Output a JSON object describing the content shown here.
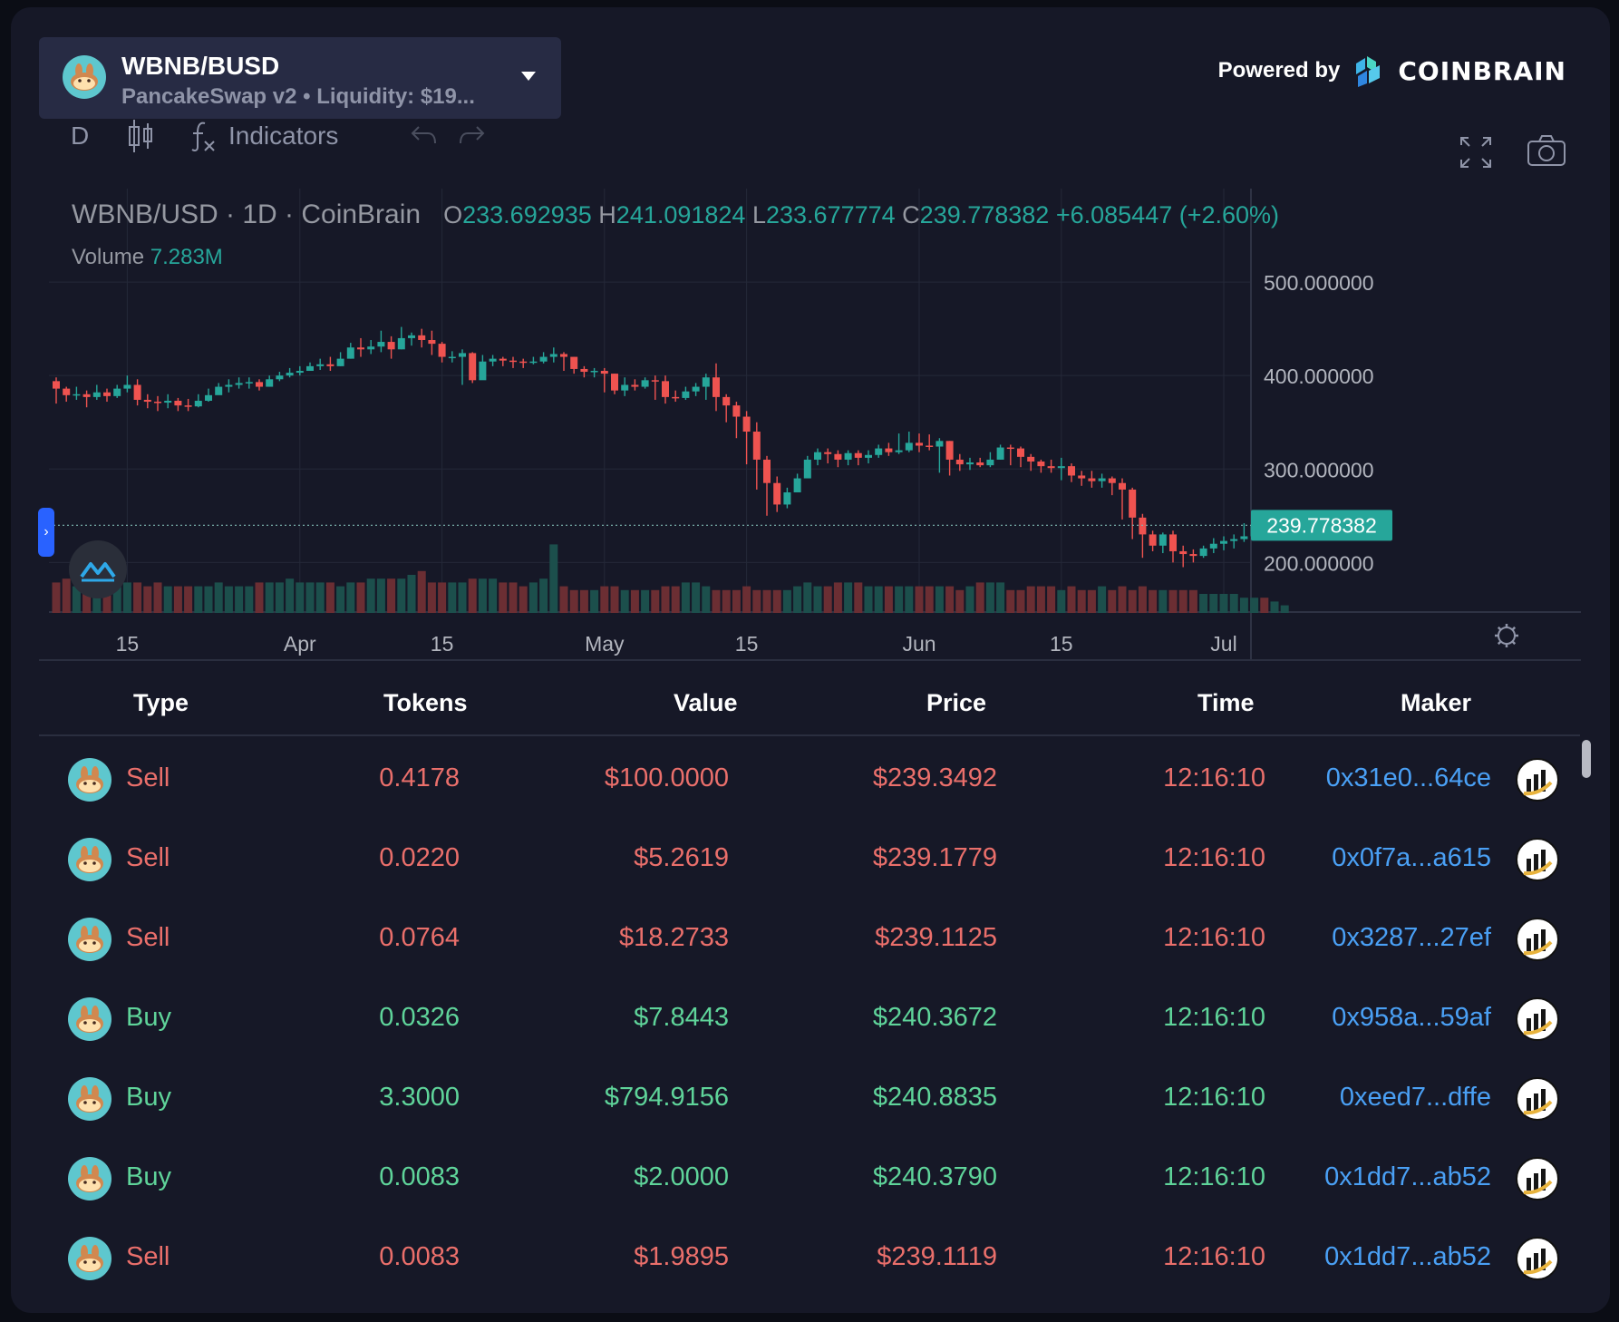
{
  "header": {
    "pair_name": "WBNB/BUSD",
    "pair_sub": "PancakeSwap v2 • Liquidity: $19...",
    "powered_by": "Powered by",
    "brand": "COINBRAIN"
  },
  "toolbar": {
    "interval": "D",
    "indicators": "Indicators"
  },
  "legend": {
    "symbol": "WBNB/USD · 1D · CoinBrain",
    "o_key": "O",
    "o": "233.692935",
    "h_key": "H",
    "h": "241.091824",
    "l_key": "L",
    "l": "233.677774",
    "c_key": "C",
    "c": "239.778382",
    "change": "+6.085447 (+2.60%)",
    "volume_label": "Volume",
    "volume_value": "7.283M"
  },
  "colors": {
    "up": "#26a69a",
    "down": "#ef5350",
    "sell": "#ea6f6b",
    "buy": "#5fd49a",
    "maker": "#4aa0f5"
  },
  "chart_data": {
    "type": "candlestick",
    "title": "WBNB/USD · 1D · CoinBrain",
    "y_ticks": [
      "500.000000",
      "400.000000",
      "300.000000",
      "200.000000"
    ],
    "y_tick_values": [
      500,
      400,
      300,
      200
    ],
    "ylim": [
      146,
      600
    ],
    "x_ticks": [
      "15",
      "Apr",
      "15",
      "May",
      "15",
      "Jun",
      "15",
      "Jul"
    ],
    "x_tick_days": [
      7,
      24,
      38,
      54,
      68,
      85,
      99,
      115
    ],
    "last_price_label": "239.778382",
    "last_price": 239.78,
    "grid": true,
    "closes": [
      386,
      379,
      380,
      377,
      382,
      378,
      386,
      390,
      374,
      372,
      371,
      373,
      368,
      367,
      373,
      379,
      388,
      390,
      392,
      393,
      388,
      396,
      400,
      403,
      405,
      410,
      412,
      410,
      418,
      430,
      428,
      431,
      436,
      428,
      440,
      443,
      438,
      434,
      420,
      420,
      424,
      395,
      415,
      418,
      416,
      415,
      414,
      415,
      420,
      423,
      420,
      407,
      404,
      405,
      402,
      384,
      390,
      388,
      395,
      394,
      377,
      376,
      383,
      388,
      398,
      377,
      368,
      356,
      340,
      310,
      285,
      262,
      275,
      290,
      310,
      318,
      316,
      310,
      317,
      312,
      315,
      322,
      318,
      320,
      328,
      325,
      324,
      330,
      310,
      305,
      307,
      304,
      310,
      323,
      322,
      313,
      308,
      303,
      301,
      303,
      293,
      290,
      287,
      290,
      285,
      278,
      248,
      230,
      218,
      230,
      212,
      209,
      207,
      215,
      220,
      223,
      225,
      228,
      240,
      236,
      237,
      239.78
    ],
    "highs": [
      398,
      388,
      388,
      384,
      390,
      386,
      390,
      400,
      396,
      380,
      378,
      380,
      376,
      375,
      380,
      386,
      392,
      396,
      398,
      398,
      396,
      400,
      404,
      408,
      410,
      414,
      418,
      420,
      425,
      435,
      440,
      438,
      448,
      442,
      452,
      446,
      450,
      448,
      436,
      426,
      428,
      425,
      422,
      422,
      420,
      420,
      418,
      420,
      425,
      430,
      425,
      420,
      410,
      408,
      408,
      402,
      398,
      396,
      398,
      400,
      400,
      384,
      388,
      392,
      402,
      413,
      380,
      372,
      362,
      350,
      314,
      292,
      280,
      295,
      314,
      322,
      322,
      320,
      320,
      320,
      320,
      326,
      328,
      338,
      340,
      338,
      337,
      333,
      330,
      316,
      312,
      312,
      318,
      326,
      326,
      324,
      316,
      310,
      310,
      312,
      306,
      298,
      298,
      295,
      292,
      290,
      280,
      252,
      234,
      232,
      234,
      218,
      214,
      218,
      226,
      228,
      230,
      242,
      242,
      242,
      240,
      243
    ],
    "lows": [
      370,
      372,
      374,
      366,
      374,
      372,
      376,
      382,
      368,
      365,
      362,
      365,
      362,
      362,
      366,
      372,
      380,
      382,
      386,
      386,
      384,
      388,
      394,
      398,
      400,
      405,
      406,
      405,
      410,
      418,
      420,
      423,
      425,
      418,
      428,
      432,
      430,
      422,
      414,
      414,
      390,
      392,
      405,
      410,
      410,
      408,
      408,
      412,
      413,
      414,
      405,
      402,
      398,
      398,
      382,
      380,
      378,
      384,
      386,
      374,
      370,
      372,
      374,
      378,
      374,
      362,
      350,
      333,
      305,
      278,
      250,
      254,
      258,
      278,
      294,
      304,
      306,
      302,
      304,
      304,
      306,
      312,
      314,
      316,
      318,
      318,
      320,
      296,
      293,
      298,
      299,
      302,
      302,
      310,
      304,
      302,
      298,
      296,
      296,
      288,
      286,
      282,
      280,
      280,
      272,
      246,
      225,
      205,
      212,
      210,
      200,
      195,
      200,
      205,
      210,
      213,
      215,
      222,
      224,
      230,
      234,
      236
    ],
    "volumes": [
      0.8,
      0.9,
      0.7,
      0.8,
      0.8,
      0.8,
      0.7,
      0.8,
      0.8,
      0.7,
      0.8,
      0.7,
      0.7,
      0.7,
      0.7,
      0.7,
      0.8,
      0.7,
      0.7,
      0.7,
      0.8,
      0.8,
      0.8,
      0.9,
      0.8,
      0.8,
      0.8,
      0.8,
      0.7,
      0.8,
      0.8,
      0.9,
      0.9,
      0.9,
      0.9,
      1.0,
      1.1,
      0.8,
      0.8,
      0.8,
      0.8,
      0.9,
      0.9,
      0.9,
      0.8,
      0.8,
      0.7,
      0.8,
      0.9,
      1.8,
      0.7,
      0.6,
      0.6,
      0.6,
      0.7,
      0.7,
      0.6,
      0.6,
      0.6,
      0.6,
      0.7,
      0.7,
      0.8,
      0.8,
      0.7,
      0.6,
      0.6,
      0.6,
      0.7,
      0.6,
      0.6,
      0.6,
      0.6,
      0.7,
      0.8,
      0.7,
      0.7,
      0.8,
      0.8,
      0.8,
      0.7,
      0.7,
      0.7,
      0.7,
      0.7,
      0.7,
      0.7,
      0.7,
      0.7,
      0.6,
      0.7,
      0.8,
      0.8,
      0.8,
      0.6,
      0.6,
      0.7,
      0.7,
      0.7,
      0.6,
      0.7,
      0.6,
      0.6,
      0.7,
      0.6,
      0.7,
      0.6,
      0.7,
      0.6,
      0.6,
      0.6,
      0.6,
      0.6,
      0.5,
      0.5,
      0.5,
      0.5,
      0.4,
      0.4,
      0.4,
      0.3,
      0.2
    ]
  },
  "table": {
    "headers": [
      "Type",
      "Tokens",
      "Value",
      "Price",
      "Time",
      "Maker"
    ],
    "rows": [
      {
        "type": "Sell",
        "tokens": "0.4178",
        "value": "$100.0000",
        "price": "$239.3492",
        "time": "12:16:10",
        "maker": "0x31e0...64ce"
      },
      {
        "type": "Sell",
        "tokens": "0.0220",
        "value": "$5.2619",
        "price": "$239.1779",
        "time": "12:16:10",
        "maker": "0x0f7a...a615"
      },
      {
        "type": "Sell",
        "tokens": "0.0764",
        "value": "$18.2733",
        "price": "$239.1125",
        "time": "12:16:10",
        "maker": "0x3287...27ef"
      },
      {
        "type": "Buy",
        "tokens": "0.0326",
        "value": "$7.8443",
        "price": "$240.3672",
        "time": "12:16:10",
        "maker": "0x958a...59af"
      },
      {
        "type": "Buy",
        "tokens": "3.3000",
        "value": "$794.9156",
        "price": "$240.8835",
        "time": "12:16:10",
        "maker": "0xeed7...dffe"
      },
      {
        "type": "Buy",
        "tokens": "0.0083",
        "value": "$2.0000",
        "price": "$240.3790",
        "time": "12:16:10",
        "maker": "0x1dd7...ab52"
      },
      {
        "type": "Sell",
        "tokens": "0.0083",
        "value": "$1.9895",
        "price": "$239.1119",
        "time": "12:16:10",
        "maker": "0x1dd7...ab52"
      }
    ]
  }
}
